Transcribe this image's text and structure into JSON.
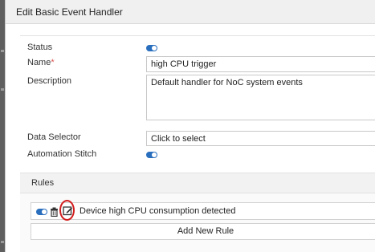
{
  "dialog": {
    "title": "Edit Basic Event Handler"
  },
  "form": {
    "status_label": "Status",
    "status_enabled": true,
    "name_label": "Name",
    "name_required_mark": "*",
    "name_value": "high CPU trigger",
    "description_label": "Description",
    "description_value": "Default handler for NoC system events",
    "data_selector_label": "Data Selector",
    "data_selector_value": "Click to select",
    "automation_stitch_label": "Automation Stitch",
    "automation_stitch_enabled": true
  },
  "rules": {
    "header_label": "Rules",
    "items": [
      {
        "text": "Device high CPU consumption detected",
        "enabled": true,
        "icons": [
          "toggle-icon",
          "trash-icon",
          "edit-icon"
        ],
        "edit_highlighted": true
      }
    ],
    "add_rule_label": "Add New Rule"
  },
  "colors": {
    "toggle_on": "#2a6fbe",
    "annotation_circle": "#d21d1d",
    "required_mark": "#d9534f"
  }
}
